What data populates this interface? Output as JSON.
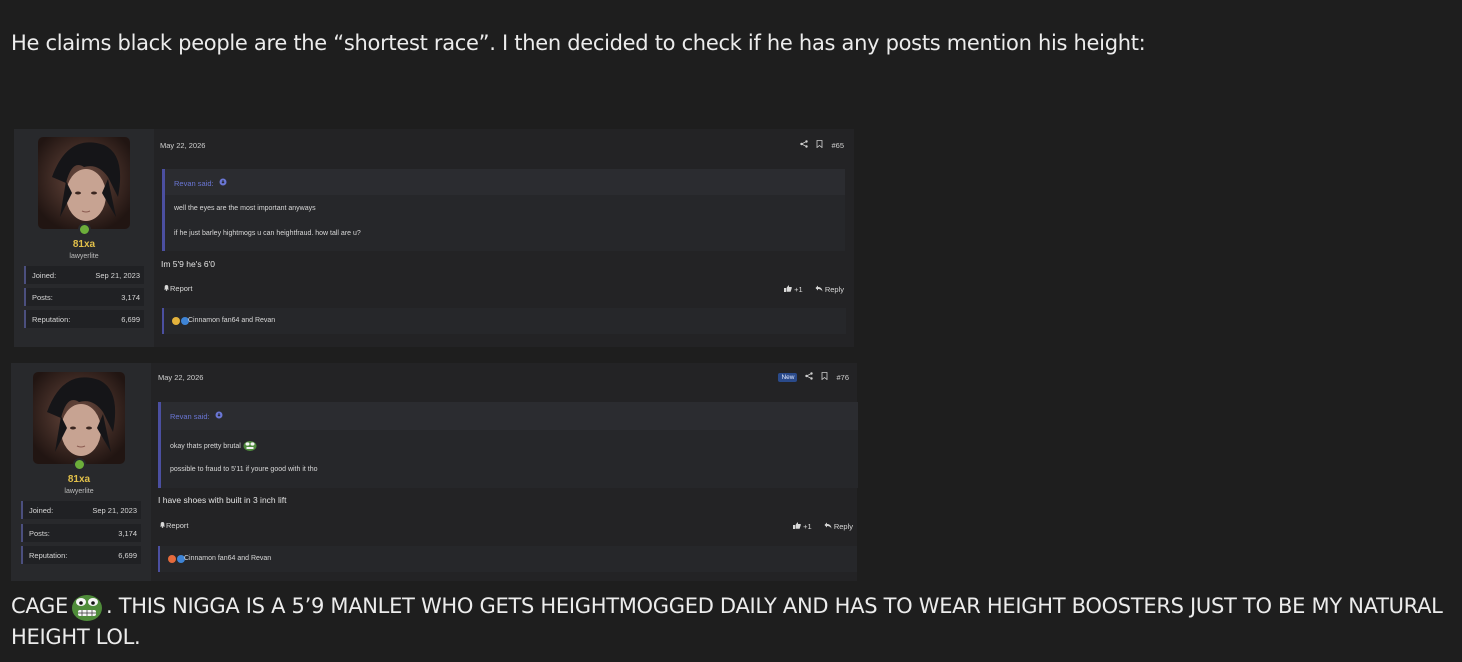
{
  "intro_text": "He claims black people are the “shortest race”. I then decided to check if he has any posts mention his height:",
  "outro_text": "CAGE . THIS NIGGA IS A 5’9 MANLET WHO GETS HEIGHTMOGGED DAILY AND HAS TO WEAR HEIGHT BOOSTERS JUST TO BE MY NATURAL HEIGHT LOL.",
  "outro_parts": {
    "before": "CAGE",
    "after": ". THIS NIGGA IS A 5’9 MANLET WHO GETS HEIGHTMOGGED DAILY AND HAS TO WEAR HEIGHT BOOSTERS JUST TO BE MY NATURAL HEIGHT LOL."
  },
  "posts": [
    {
      "date": "May 22, 2026",
      "post_number": "#65",
      "new_badge": "",
      "username": "81xa",
      "user_title": "lawyerlite",
      "stats": [
        {
          "k": "Joined:",
          "v": "Sep 21, 2023"
        },
        {
          "k": "Posts:",
          "v": "3,174"
        },
        {
          "k": "Reputation:",
          "v": "6,699"
        }
      ],
      "quote_author": "Revan said:",
      "quote_lines": [
        "well the eyes are the most important anyways",
        "if he just barley hightmogs u can heightfraud. how tall are u?"
      ],
      "message": "Im 5'9 he's 6'0",
      "report": "Report",
      "like_count": "+1",
      "reply": "Reply",
      "reactions_text": "Cinnamon fan64 and Revan"
    },
    {
      "date": "May 22, 2026",
      "post_number": "#76",
      "new_badge": "New",
      "username": "81xa",
      "user_title": "lawyerlite",
      "stats": [
        {
          "k": "Joined:",
          "v": "Sep 21, 2023"
        },
        {
          "k": "Posts:",
          "v": "3,174"
        },
        {
          "k": "Reputation:",
          "v": "6,699"
        }
      ],
      "quote_author": "Revan said:",
      "quote_lines": [
        "okay thats pretty brutal",
        "possible to fraud to 5'11 if youre good with it tho"
      ],
      "message": "I have shoes with built in 3 inch lift",
      "report": "Report",
      "like_count": "+1",
      "reply": "Reply",
      "reactions_text": "Cinnamon fan64 and Revan"
    }
  ],
  "colors": {
    "background": "#1e1e1e",
    "username": "#e2c04a",
    "quote_link": "#6a76d4",
    "accent_border": "#4b4fa0"
  },
  "icons": [
    "share-icon",
    "bookmark-icon",
    "bell-icon",
    "thumbs-up-icon",
    "reply-arrow-icon",
    "info-circle-icon",
    "pepe-emoji-icon"
  ]
}
